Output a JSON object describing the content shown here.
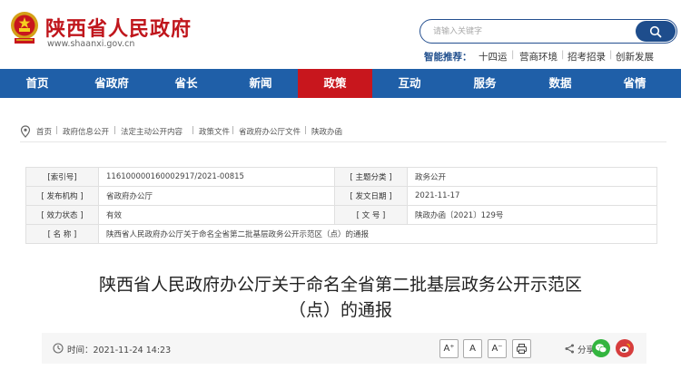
{
  "header": {
    "title": "陕西省人民政府",
    "url": "www.shaanxi.gov.cn",
    "search_placeholder": "请输入关键字",
    "hot_label": "智能推荐：",
    "hot_items": [
      "十四运",
      "营商环境",
      "招考招录",
      "创新发展"
    ]
  },
  "nav": {
    "items": [
      "首页",
      "省政府",
      "省长",
      "新闻",
      "政策",
      "互动",
      "服务",
      "数据",
      "省情"
    ],
    "active": "政策",
    "colors": {
      "bar": "#1f5fa8",
      "active": "#c8161d"
    }
  },
  "breadcrumb": [
    "首页",
    "政府信息公开",
    "法定主动公开内容",
    "政策文件",
    "省政府办公厅文件",
    "陕政办函"
  ],
  "info": {
    "index_label": "[索引号]",
    "index_value": "116100000160002917/2021-00815",
    "category_label": "[ 主题分类 ]",
    "category_value": "政务公开",
    "issuer_label": "[ 发布机构 ]",
    "issuer_value": "省政府办公厅",
    "date_label": "[ 发文日期 ]",
    "date_value": "2021-11-17",
    "status_label": "[ 效力状态 ]",
    "status_value": "有效",
    "docno_label": "[ 文   号 ]",
    "docno_value": "陕政办函〔2021〕129号",
    "name_label": "[ 名   称 ]",
    "name_value": "陕西省人民政府办公厅关于命名全省第二批基层政务公开示范区（点）的通报"
  },
  "document": {
    "title_line1": "陕西省人民政府办公厅关于命名全省第二批基层政务公开示范区",
    "title_line2": "（点）的通报"
  },
  "toolbar": {
    "time_label": "时间：",
    "time_value": "2021-11-24 14:23",
    "font_larger": "A⁺",
    "font_normal": "A",
    "font_smaller": "A⁻",
    "share_label": "分享:"
  }
}
